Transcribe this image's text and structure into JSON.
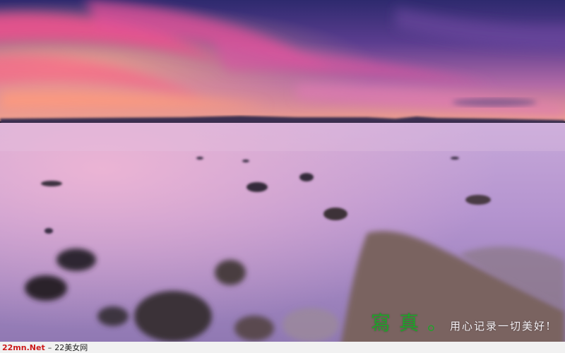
{
  "photo": {
    "subject": "sunset-over-calm-sea-with-rocks",
    "colors": {
      "sky_top": "#3b2f7a",
      "sky_pink": "#e3548d",
      "horizon_glow": "#f59a7a",
      "water_light": "#c9a9d6",
      "water_dark": "#6f5b8f"
    }
  },
  "watermark": {
    "main": "寫真",
    "dot": "。",
    "slogan": "用心记录一切美好!"
  },
  "footer": {
    "site": "22mn.Net",
    "separator": "–",
    "name": "22美女网"
  }
}
